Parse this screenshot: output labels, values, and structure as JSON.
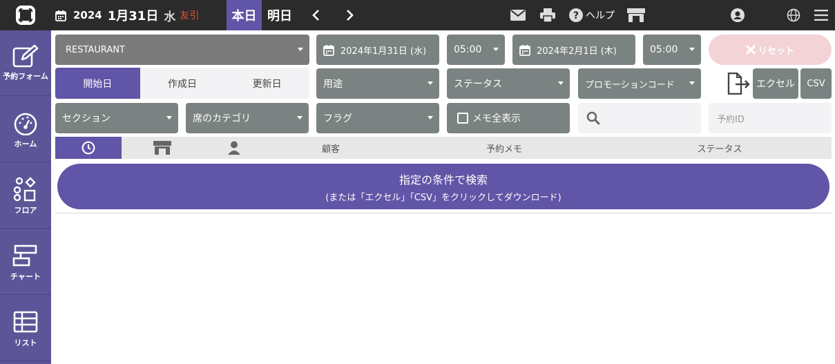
{
  "header": {
    "year": "2024",
    "month_day": "1月31日",
    "weekday": "水",
    "rokuyo": "友引",
    "today_label": "本日",
    "tomorrow_label": "明日",
    "help_label": "ヘルプ"
  },
  "sidebar": {
    "items": [
      {
        "label": "予約フォーム",
        "icon": "edit-icon"
      },
      {
        "label": "ホーム",
        "icon": "gauge-icon"
      },
      {
        "label": "フロア",
        "icon": "floor-shapes-icon"
      },
      {
        "label": "チャート",
        "icon": "chart-blocks-icon"
      },
      {
        "label": "リスト",
        "icon": "list-table-icon"
      }
    ]
  },
  "filters": {
    "venue": "RESTAURANT",
    "start_date": "2024年1月31日 (水)",
    "start_time": "05:00",
    "end_date": "2024年2月1日 (木)",
    "end_time": "05:00",
    "reset_label": "リセット",
    "date_type_tabs": [
      "開始日",
      "作成日",
      "更新日"
    ],
    "purpose_placeholder": "用途",
    "status_placeholder": "ステータス",
    "promo_placeholder": "プロモーションコード",
    "excel_label": "エクセル",
    "csv_label": "CSV",
    "section_placeholder": "セクション",
    "seat_category_placeholder": "席のカテゴリ",
    "flag_placeholder": "フラグ",
    "memo_all_label": "メモ全表示",
    "reservation_id_placeholder": "予約ID"
  },
  "table": {
    "columns": [
      "顧客",
      "予約メモ",
      "ステータス"
    ]
  },
  "search_button": {
    "line1": "指定の条件で検索",
    "line2": "(または「エクセル」「CSV」をクリックしてダウンロード)"
  },
  "colors": {
    "accent": "#6055a6",
    "topbar": "#2b2b2b",
    "sidebar": "#5c5597",
    "dropdown": "#7b8382",
    "reset": "#f3d3d6"
  }
}
